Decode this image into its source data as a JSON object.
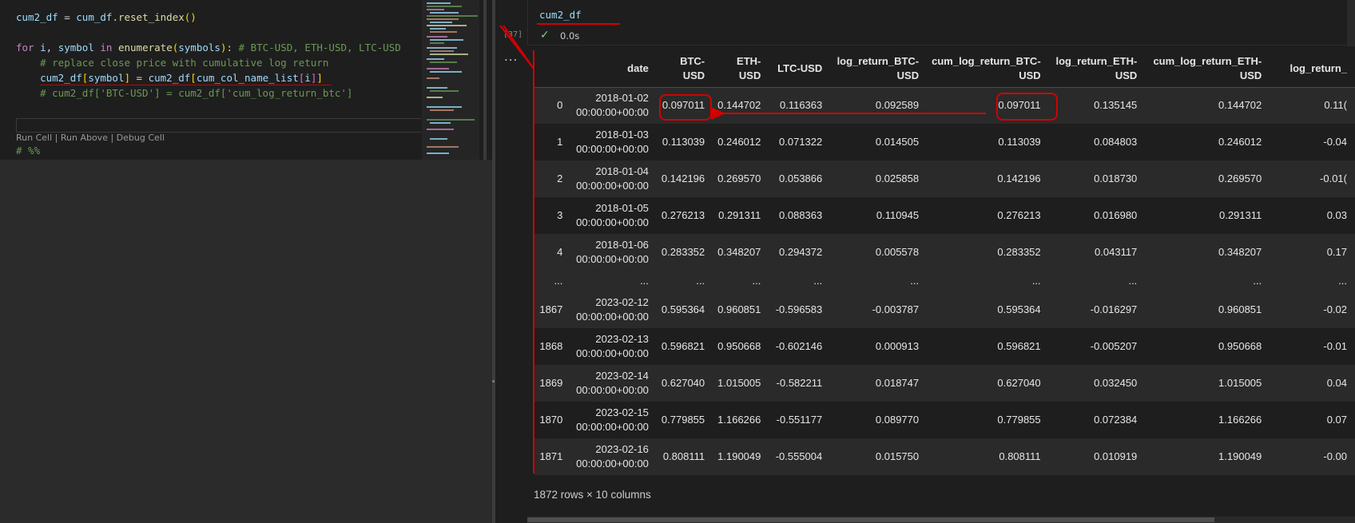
{
  "editor": {
    "lines": [
      "cum2_df = cum_df.reset_index()",
      "",
      "for i, symbol in enumerate(symbols): # BTC-USD, ETH-USD, LTC-USD",
      "    # replace close price with cumulative log return",
      "    cum2_df[symbol] = cum2_df[cum_col_name_list[i]]",
      "    # cum2_df['BTC-USD'] = cum2_df['cum_log_return_btc']"
    ],
    "codelens": {
      "run_cell": "Run Cell",
      "sep1": " | ",
      "run_above": "Run Above",
      "sep2": " | ",
      "debug_cell": "Debug Cell"
    },
    "next_line": "# %%"
  },
  "notebook": {
    "input_code": "cum2_df",
    "exec_count": "[37]",
    "status_icon": "check-icon",
    "exec_time": "0.0s",
    "more_icon": "..."
  },
  "dataframe": {
    "columns": [
      "",
      "date",
      "BTC-USD",
      "ETH-USD",
      "LTC-USD",
      "log_return_BTC-USD",
      "cum_log_return_BTC-USD",
      "log_return_ETH-USD",
      "cum_log_return_ETH-USD",
      "log_return_"
    ],
    "rows": [
      [
        "0",
        "2018-01-02 00:00:00+00:00",
        "0.097011",
        "0.144702",
        "0.116363",
        "0.092589",
        "0.097011",
        "0.135145",
        "0.144702",
        "0.11("
      ],
      [
        "1",
        "2018-01-03 00:00:00+00:00",
        "0.113039",
        "0.246012",
        "0.071322",
        "0.014505",
        "0.113039",
        "0.084803",
        "0.246012",
        "-0.04"
      ],
      [
        "2",
        "2018-01-04 00:00:00+00:00",
        "0.142196",
        "0.269570",
        "0.053866",
        "0.025858",
        "0.142196",
        "0.018730",
        "0.269570",
        "-0.01("
      ],
      [
        "3",
        "2018-01-05 00:00:00+00:00",
        "0.276213",
        "0.291311",
        "0.088363",
        "0.110945",
        "0.276213",
        "0.016980",
        "0.291311",
        "0.03"
      ],
      [
        "4",
        "2018-01-06 00:00:00+00:00",
        "0.283352",
        "0.348207",
        "0.294372",
        "0.005578",
        "0.283352",
        "0.043117",
        "0.348207",
        "0.17"
      ],
      [
        "...",
        "...",
        "...",
        "...",
        "...",
        "...",
        "...",
        "...",
        "...",
        "..."
      ],
      [
        "1867",
        "2023-02-12 00:00:00+00:00",
        "0.595364",
        "0.960851",
        "-0.596583",
        "-0.003787",
        "0.595364",
        "-0.016297",
        "0.960851",
        "-0.02"
      ],
      [
        "1868",
        "2023-02-13 00:00:00+00:00",
        "0.596821",
        "0.950668",
        "-0.602146",
        "0.000913",
        "0.596821",
        "-0.005207",
        "0.950668",
        "-0.01"
      ],
      [
        "1869",
        "2023-02-14 00:00:00+00:00",
        "0.627040",
        "1.015005",
        "-0.582211",
        "0.018747",
        "0.627040",
        "0.032450",
        "1.015005",
        "0.04"
      ],
      [
        "1870",
        "2023-02-15 00:00:00+00:00",
        "0.779855",
        "1.166266",
        "-0.551177",
        "0.089770",
        "0.779855",
        "0.072384",
        "1.166266",
        "0.07"
      ],
      [
        "1871",
        "2023-02-16 00:00:00+00:00",
        "0.808111",
        "1.190049",
        "-0.555004",
        "0.015750",
        "0.808111",
        "0.010919",
        "1.190049",
        "-0.00"
      ]
    ],
    "shape": "1872 rows × 10 columns"
  },
  "colors": {
    "annotation_red": "#d40000",
    "keyword": "#c586c0",
    "variable": "#9cdcfe",
    "function": "#dcdcaa",
    "comment": "#6a9955",
    "string": "#ce9178"
  }
}
